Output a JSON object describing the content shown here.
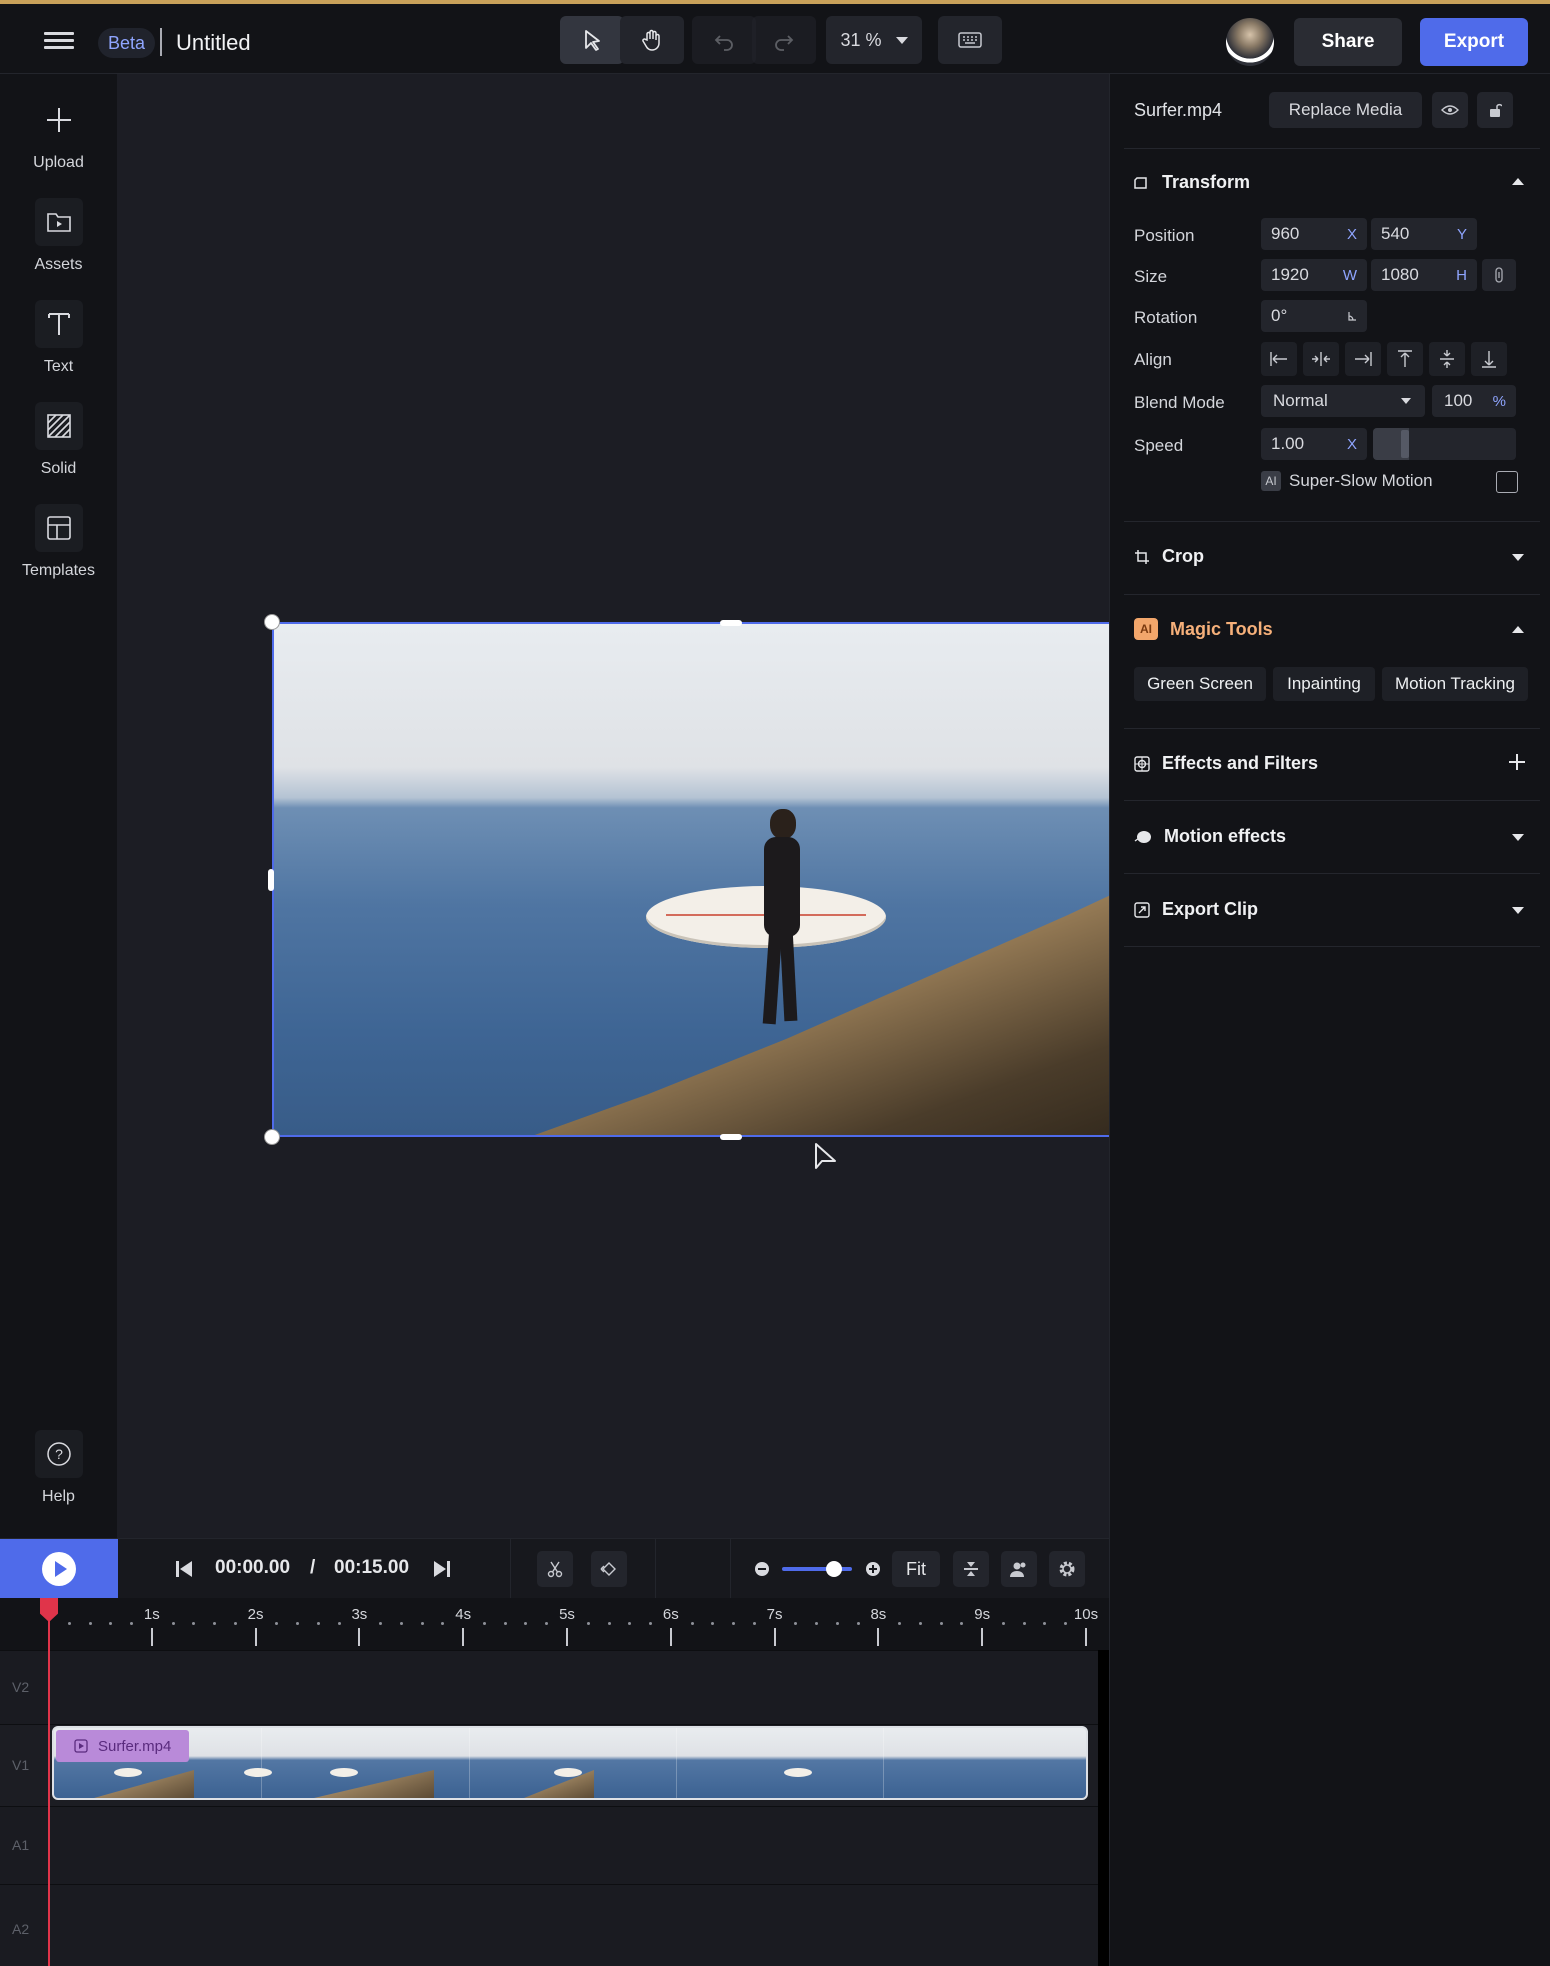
{
  "header": {
    "beta_label": "Beta",
    "title": "Untitled",
    "zoom": "31 %",
    "share_label": "Share",
    "export_label": "Export"
  },
  "sidebar": {
    "items": [
      {
        "label": "Upload",
        "icon": "plus-icon"
      },
      {
        "label": "Assets",
        "icon": "folder-play-icon"
      },
      {
        "label": "Text",
        "icon": "text-icon"
      },
      {
        "label": "Solid",
        "icon": "hatch-icon"
      },
      {
        "label": "Templates",
        "icon": "layout-icon"
      }
    ],
    "help_label": "Help"
  },
  "properties": {
    "file_name": "Surfer.mp4",
    "replace_label": "Replace Media",
    "transform": {
      "title": "Transform",
      "position_label": "Position",
      "position_x": "960",
      "position_x_unit": "X",
      "position_y": "540",
      "position_y_unit": "Y",
      "size_label": "Size",
      "size_w": "1920",
      "size_w_unit": "W",
      "size_h": "1080",
      "size_h_unit": "H",
      "rotation_label": "Rotation",
      "rotation": "0°",
      "align_label": "Align",
      "blend_label": "Blend Mode",
      "blend_mode": "Normal",
      "opacity": "100",
      "opacity_unit": "%",
      "speed_label": "Speed",
      "speed": "1.00",
      "speed_unit": "X",
      "ai_badge": "AI",
      "super_slow_label": "Super-Slow Motion"
    },
    "crop_title": "Crop",
    "magic": {
      "title": "Magic Tools",
      "badge": "AI",
      "buttons": [
        "Green Screen",
        "Inpainting",
        "Motion Tracking"
      ]
    },
    "effects_title": "Effects and Filters",
    "motion_title": "Motion effects",
    "export_clip_title": "Export Clip"
  },
  "timeline": {
    "current_time": "00:00.00",
    "separator": "/",
    "total_time": "00:15.00",
    "fit_label": "Fit",
    "ruler_labels": [
      "1s",
      "2s",
      "3s",
      "4s",
      "5s",
      "6s",
      "7s",
      "8s",
      "9s",
      "10s"
    ],
    "tracks": [
      "V2",
      "V1",
      "A1",
      "A2"
    ],
    "clip_name": "Surfer.mp4"
  },
  "colors": {
    "accent": "#4f6bea",
    "playhead": "#e0344a",
    "clip_label": "#b98ad9",
    "ai_badge": "#f2a66b"
  }
}
